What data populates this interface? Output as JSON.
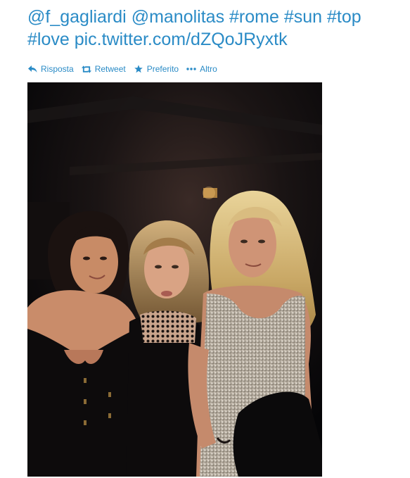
{
  "tweet": {
    "mentions": [
      "@f_gagliardi",
      "@manolitas"
    ],
    "hashtags": [
      "#rome",
      "#sun",
      "#top",
      "#love"
    ],
    "link": "pic.twitter.com/dZQoJRyxtk"
  },
  "actions": {
    "reply": "Risposta",
    "retweet": "Retweet",
    "favorite": "Preferito",
    "more": "Altro"
  },
  "colors": {
    "link": "#2a8bc6",
    "icon": "#2a8bc6",
    "photo_background": "#08080a"
  },
  "icons": {
    "reply": "reply-arrow-icon",
    "retweet": "retweet-icon",
    "favorite": "star-icon",
    "more": "ellipsis-icon"
  }
}
